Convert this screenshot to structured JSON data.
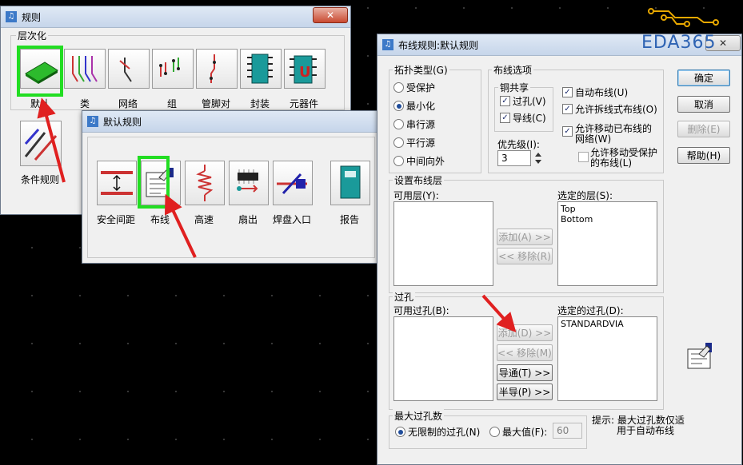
{
  "rules_window": {
    "title": "规则",
    "close": "✕",
    "section": "层次化",
    "tools": [
      {
        "label": "默认",
        "icon": "pcb-board-icon"
      },
      {
        "label": "类",
        "icon": "net-class-icon"
      },
      {
        "label": "网络",
        "icon": "net-icon"
      },
      {
        "label": "组",
        "icon": "group-icon"
      },
      {
        "label": "管脚对",
        "icon": "pin-pair-icon"
      },
      {
        "label": "封装",
        "icon": "package-icon"
      },
      {
        "label": "元器件",
        "icon": "component-icon"
      }
    ],
    "conditional_label": "条件规则"
  },
  "default_rules_window": {
    "title": "默认规则",
    "tools": [
      {
        "label": "安全间距",
        "icon": "clearance-icon"
      },
      {
        "label": "布线",
        "icon": "routing-icon"
      },
      {
        "label": "高速",
        "icon": "high-speed-icon"
      },
      {
        "label": "扇出",
        "icon": "fanout-icon"
      },
      {
        "label": "焊盘入口",
        "icon": "pad-entry-icon"
      },
      {
        "label": "报告",
        "icon": "report-icon"
      }
    ]
  },
  "routing_dialog": {
    "title": "布线规则:默认规则",
    "topology": {
      "title": "拓扑类型(G)",
      "options": [
        "受保护",
        "最小化",
        "串行源",
        "平行源",
        "中间向外"
      ],
      "selected": "最小化"
    },
    "routing_options": {
      "title": "布线选项",
      "copper_share": {
        "title": "铜共享",
        "via": "过孔(V)",
        "trace": "导线(C)"
      },
      "auto_route": "自动布线(U)",
      "allow_shove": "允许拆线式布线(O)",
      "allow_move_routed": [
        "允许移动已布线的",
        "网络(W)"
      ],
      "allow_move_protected": [
        "允许移动受保护",
        "的布线(L)"
      ],
      "priority_label": "优先级(I):",
      "priority_value": "3"
    },
    "layers": {
      "title": "设置布线层",
      "available_label": "可用层(Y):",
      "selected_label": "选定的层(S):",
      "selected_items": [
        "Top",
        "Bottom"
      ],
      "add": "添加(A) >>",
      "remove": "<< 移除(R)"
    },
    "vias": {
      "title": "过孔",
      "available_label": "可用过孔(B):",
      "selected_label": "选定的过孔(D):",
      "selected_items": [
        "STANDARDVIA"
      ],
      "add": "添加(D) >>",
      "remove": "<< 移除(M)",
      "through": "导通(T) >>",
      "partial": "半导(P) >>"
    },
    "max_vias": {
      "title": "最大过孔数",
      "unlimited": "无限制的过孔(N)",
      "max_value_label": "最大值(F):",
      "max_value": "60"
    },
    "hint": [
      "提示: 最大过孔数仅适",
      "用于自动布线"
    ],
    "buttons": {
      "ok": "确定",
      "cancel": "取消",
      "delete": "删除(E)",
      "help": "帮助(H)"
    },
    "close": "✕"
  },
  "watermark": "EDA365",
  "colors": {
    "highlight": "#22dd22",
    "arrow": "#e02020",
    "logo": "#2e63b3"
  }
}
